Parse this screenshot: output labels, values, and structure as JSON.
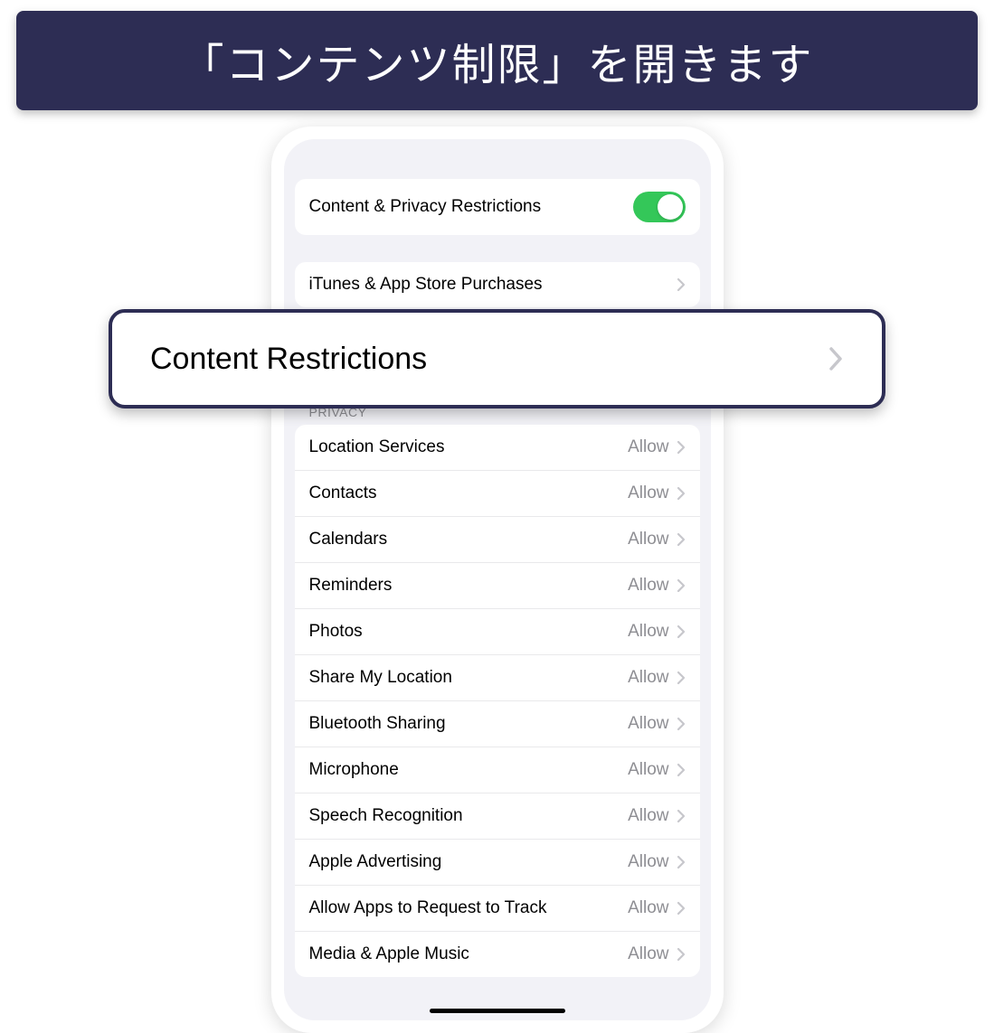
{
  "banner": {
    "text": "「コンテンツ制限」を開きます"
  },
  "toggleRow": {
    "label": "Content & Privacy Restrictions",
    "on": true
  },
  "storeRow": {
    "label": "iTunes & App Store Purchases"
  },
  "callout": {
    "label": "Content Restrictions"
  },
  "privacyHeader": "PRIVACY",
  "privacyRows": [
    {
      "label": "Location Services",
      "value": "Allow"
    },
    {
      "label": "Contacts",
      "value": "Allow"
    },
    {
      "label": "Calendars",
      "value": "Allow"
    },
    {
      "label": "Reminders",
      "value": "Allow"
    },
    {
      "label": "Photos",
      "value": "Allow"
    },
    {
      "label": "Share My Location",
      "value": "Allow"
    },
    {
      "label": "Bluetooth Sharing",
      "value": "Allow"
    },
    {
      "label": "Microphone",
      "value": "Allow"
    },
    {
      "label": "Speech Recognition",
      "value": "Allow"
    },
    {
      "label": "Apple Advertising",
      "value": "Allow"
    },
    {
      "label": "Allow Apps to Request to Track",
      "value": "Allow"
    },
    {
      "label": "Media & Apple Music",
      "value": "Allow"
    }
  ]
}
